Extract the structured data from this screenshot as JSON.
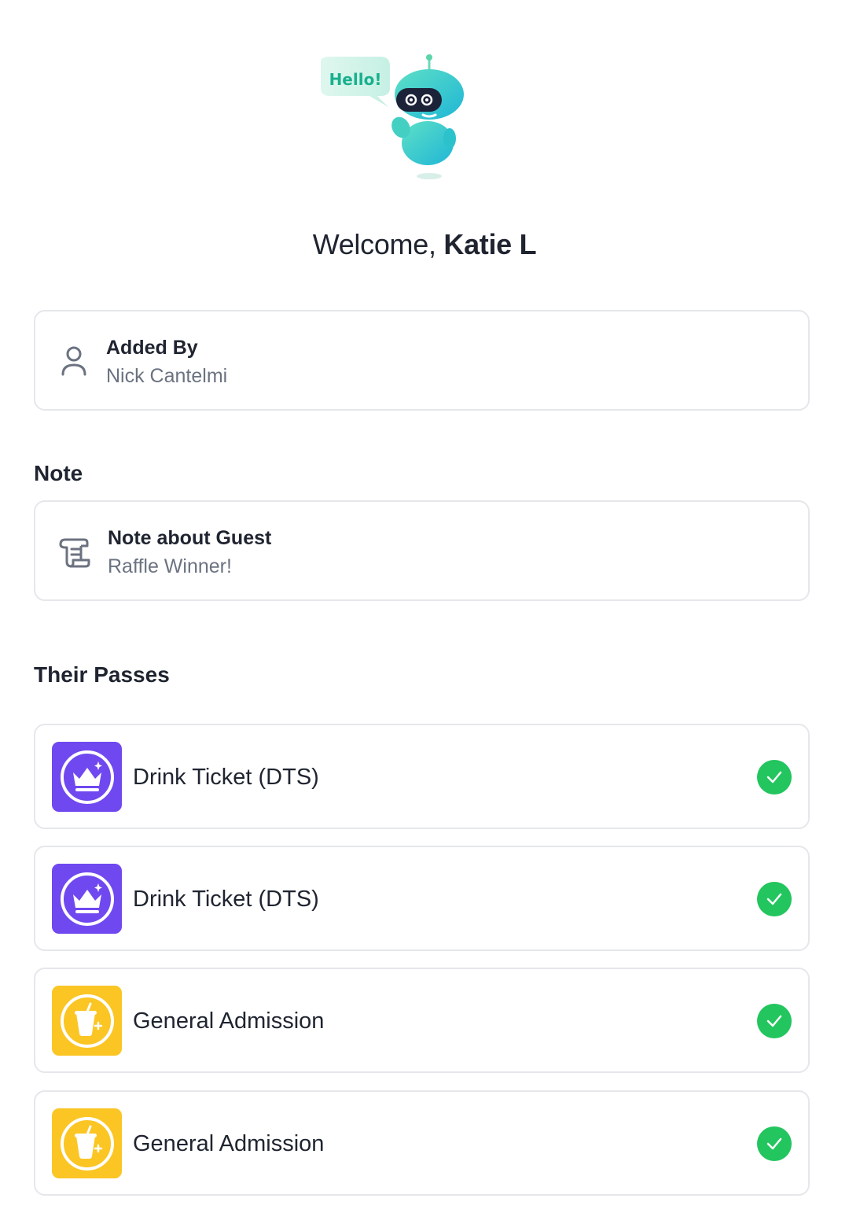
{
  "mascot": {
    "speech": "Hello!"
  },
  "welcome": {
    "prefix": "Welcome, ",
    "name": "Katie L"
  },
  "added_by": {
    "label": "Added By",
    "value": "Nick Cantelmi",
    "icon": "user-icon"
  },
  "note_section": {
    "heading": "Note",
    "title": "Note about Guest",
    "value": "Raffle Winner!",
    "icon": "scroll-icon"
  },
  "passes_section": {
    "heading": "Their Passes",
    "items": [
      {
        "name": "Drink Ticket (DTS)",
        "icon": "crown-icon",
        "color": "#7048f0",
        "status": "checked"
      },
      {
        "name": "Drink Ticket (DTS)",
        "icon": "crown-icon",
        "color": "#7048f0",
        "status": "checked"
      },
      {
        "name": "General Admission",
        "icon": "drink-cup-icon",
        "color": "#fbc524",
        "status": "checked"
      },
      {
        "name": "General Admission",
        "icon": "drink-cup-icon",
        "color": "#fbc524",
        "status": "checked"
      }
    ]
  },
  "colors": {
    "check_green": "#22c55e",
    "border": "#e5e7eb",
    "muted_text": "#6b7280"
  }
}
